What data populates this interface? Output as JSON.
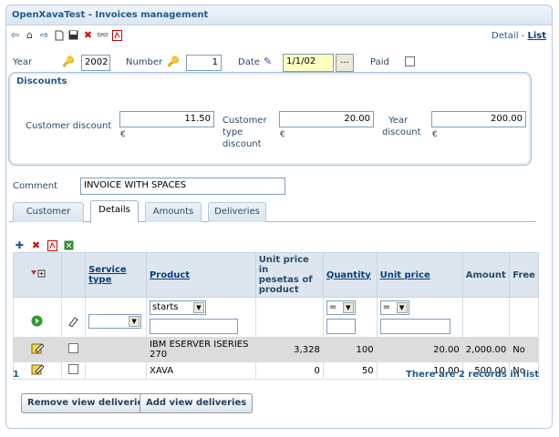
{
  "window": {
    "title": "OpenXavaTest - Invoices management"
  },
  "toolbar": {
    "icons": [
      "arrow-left-icon",
      "home-icon",
      "arrow-right-icon",
      "new-document-icon",
      "save-icon",
      "delete-icon",
      "search-icon",
      "pdf-icon"
    ]
  },
  "view_switch": {
    "detail": "Detail",
    "separator": " - ",
    "list": "List"
  },
  "header": {
    "year_label": "Year",
    "year_value": "2002",
    "number_label": "Number",
    "number_value": "1",
    "date_label": "Date",
    "date_value": "1/1/02",
    "date_button": "...",
    "paid_label": "Paid",
    "paid_checked": false
  },
  "discounts": {
    "title": "Discounts",
    "customer_label": "Customer discount",
    "customer_value": "11.50",
    "type_label_1": "Customer",
    "type_label_2": "type",
    "type_label_3": "discount",
    "type_value": "20.00",
    "year_label_1": "Year",
    "year_label_2": "discount",
    "year_value": "200.00",
    "currency": "€"
  },
  "comment": {
    "label": "Comment",
    "value": "INVOICE WITH SPACES"
  },
  "tabs": [
    "Customer",
    "Details",
    "Amounts",
    "Deliveries"
  ],
  "active_tab": "Details",
  "details": {
    "columns": {
      "service_type": "Service type",
      "product": "Product",
      "unit_price_pesetas_1": "Unit price in",
      "unit_price_pesetas_2": "pesetas of",
      "unit_price_pesetas_3": "product",
      "quantity": "Quantity",
      "unit_price": "Unit price",
      "amount": "Amount",
      "free": "Free"
    },
    "filters": {
      "product_op": "starts",
      "quantity_op": "=",
      "unit_price_op": "="
    },
    "rows": [
      {
        "product_1": "IBM ESERVER ISERIES",
        "product_2": "270",
        "pesetas": "3,328",
        "quantity": "100",
        "unit_price": "20.00",
        "amount": "2,000.00",
        "free": "No"
      },
      {
        "product_1": "XAVA",
        "product_2": "",
        "pesetas": "0",
        "quantity": "50",
        "unit_price": "10.00",
        "amount": "500.00",
        "free": "No"
      }
    ],
    "page": "1",
    "records_text": "There are 2 records in list"
  },
  "buttons": {
    "remove_view_deliveries": "Remove view deliveries",
    "add_view_deliveries": "Add view deliveries"
  },
  "colors": {
    "accent": "#1f5a8c",
    "header_bg": "#dde6ef",
    "date_bg": "#ffffc0"
  }
}
